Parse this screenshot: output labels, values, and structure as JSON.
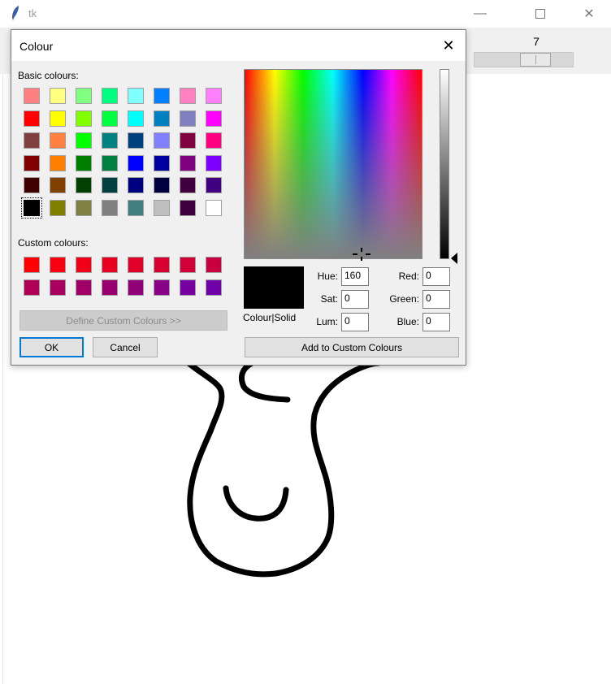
{
  "window": {
    "title": "tk"
  },
  "scale": {
    "value": "7"
  },
  "dialog": {
    "title": "Colour",
    "basic_label": "Basic colours:",
    "custom_label": "Custom colours:",
    "basic_colours": [
      "#ff8080",
      "#ffff80",
      "#80ff80",
      "#00ff80",
      "#80ffff",
      "#0080ff",
      "#ff80c0",
      "#ff80ff",
      "#ff0000",
      "#ffff00",
      "#80ff00",
      "#00ff40",
      "#00ffff",
      "#0080c0",
      "#8080c0",
      "#ff00ff",
      "#804040",
      "#ff8040",
      "#00ff00",
      "#008080",
      "#004080",
      "#8080ff",
      "#800040",
      "#ff0080",
      "#800000",
      "#ff8000",
      "#008000",
      "#008040",
      "#0000ff",
      "#0000a0",
      "#800080",
      "#8000ff",
      "#400000",
      "#804000",
      "#004000",
      "#004040",
      "#000080",
      "#000040",
      "#400040",
      "#400080",
      "#000000",
      "#808000",
      "#808040",
      "#808080",
      "#408080",
      "#c0c0c0",
      "#400040",
      "#ffffff"
    ],
    "selected_basic_index": 40,
    "custom_colours": [
      "#ff0000",
      "#f80010",
      "#f00018",
      "#e80020",
      "#e00028",
      "#d80030",
      "#d00038",
      "#c80040",
      "#b00058",
      "#a80060",
      "#a00068",
      "#980070",
      "#900078",
      "#880088",
      "#7800a0",
      "#7000a8"
    ],
    "define_label": "Define Custom Colours >>",
    "ok_label": "OK",
    "cancel_label": "Cancel",
    "preview_label": "Colour|Solid",
    "preview_colour": "#000000",
    "hue": {
      "label": "Hue:",
      "value": "160"
    },
    "sat": {
      "label": "Sat:",
      "value": "0"
    },
    "lum": {
      "label": "Lum:",
      "value": "0"
    },
    "red": {
      "label": "Red:",
      "value": "0"
    },
    "green": {
      "label": "Green:",
      "value": "0"
    },
    "blue": {
      "label": "Blue:",
      "value": "0"
    },
    "add_label": "Add to Custom Colours"
  },
  "icons": [
    "tk-feather-icon",
    "minimize-icon",
    "maximize-icon",
    "close-icon",
    "crosshair-icon",
    "luminance-arrow-icon"
  ]
}
